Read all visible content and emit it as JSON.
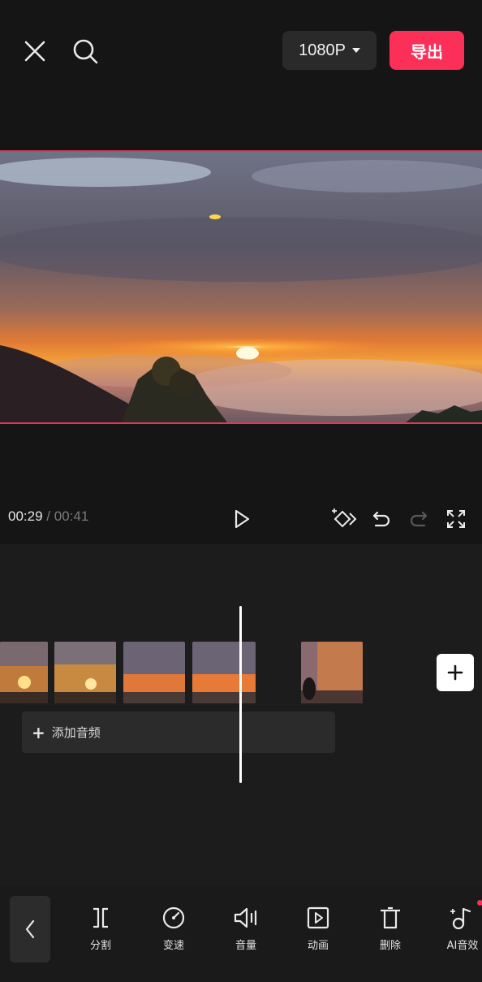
{
  "topbar": {
    "resolution_label": "1080P",
    "export_label": "导出",
    "export_color": "#fb2f57"
  },
  "playback": {
    "current_time": "00:29",
    "separator": "/",
    "total_time": "00:41"
  },
  "timeline": {
    "add_audio_label": "添加音频"
  },
  "toolbar": {
    "items": [
      {
        "label": "分割",
        "icon": "split-icon"
      },
      {
        "label": "变速",
        "icon": "speed-icon"
      },
      {
        "label": "音量",
        "icon": "volume-icon"
      },
      {
        "label": "动画",
        "icon": "animation-icon"
      },
      {
        "label": "删除",
        "icon": "delete-icon"
      },
      {
        "label": "AI音效",
        "icon": "ai-sound-effect-icon"
      }
    ]
  }
}
